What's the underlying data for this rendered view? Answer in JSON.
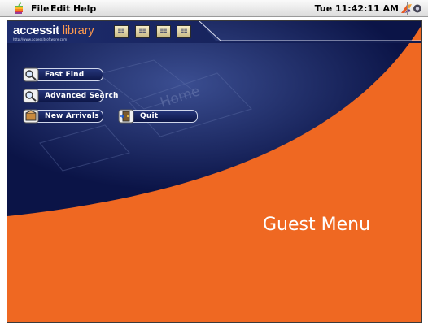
{
  "menubar": {
    "items": [
      "File",
      "Edit",
      "Help"
    ],
    "clock": "Tue 11:42:11 AM"
  },
  "logo": {
    "name_access": "access",
    "name_it": "it",
    "name_library": "library",
    "url": "http://www.accessitsoftware.com"
  },
  "toolbar": {
    "buttons": [
      {
        "name": "toolbar-button-1",
        "glyph": "≡≡"
      },
      {
        "name": "toolbar-button-2",
        "glyph": "≡≡"
      },
      {
        "name": "toolbar-button-3",
        "glyph": "≡≡"
      },
      {
        "name": "toolbar-button-4",
        "glyph": "≡≡"
      }
    ]
  },
  "menu": {
    "title": "Guest Menu",
    "buttons": [
      {
        "label": "Fast Find",
        "icon": "magnifier-icon"
      },
      {
        "label": "Advanced Search",
        "icon": "magnifier-icon"
      },
      {
        "label": "New Arrivals",
        "icon": "new-arrivals-icon"
      },
      {
        "label": "Quit",
        "icon": "door-exit-icon"
      }
    ]
  },
  "colors": {
    "navy": "#0a1248",
    "orange": "#ef6822",
    "button_border": "#cfd6ea"
  }
}
